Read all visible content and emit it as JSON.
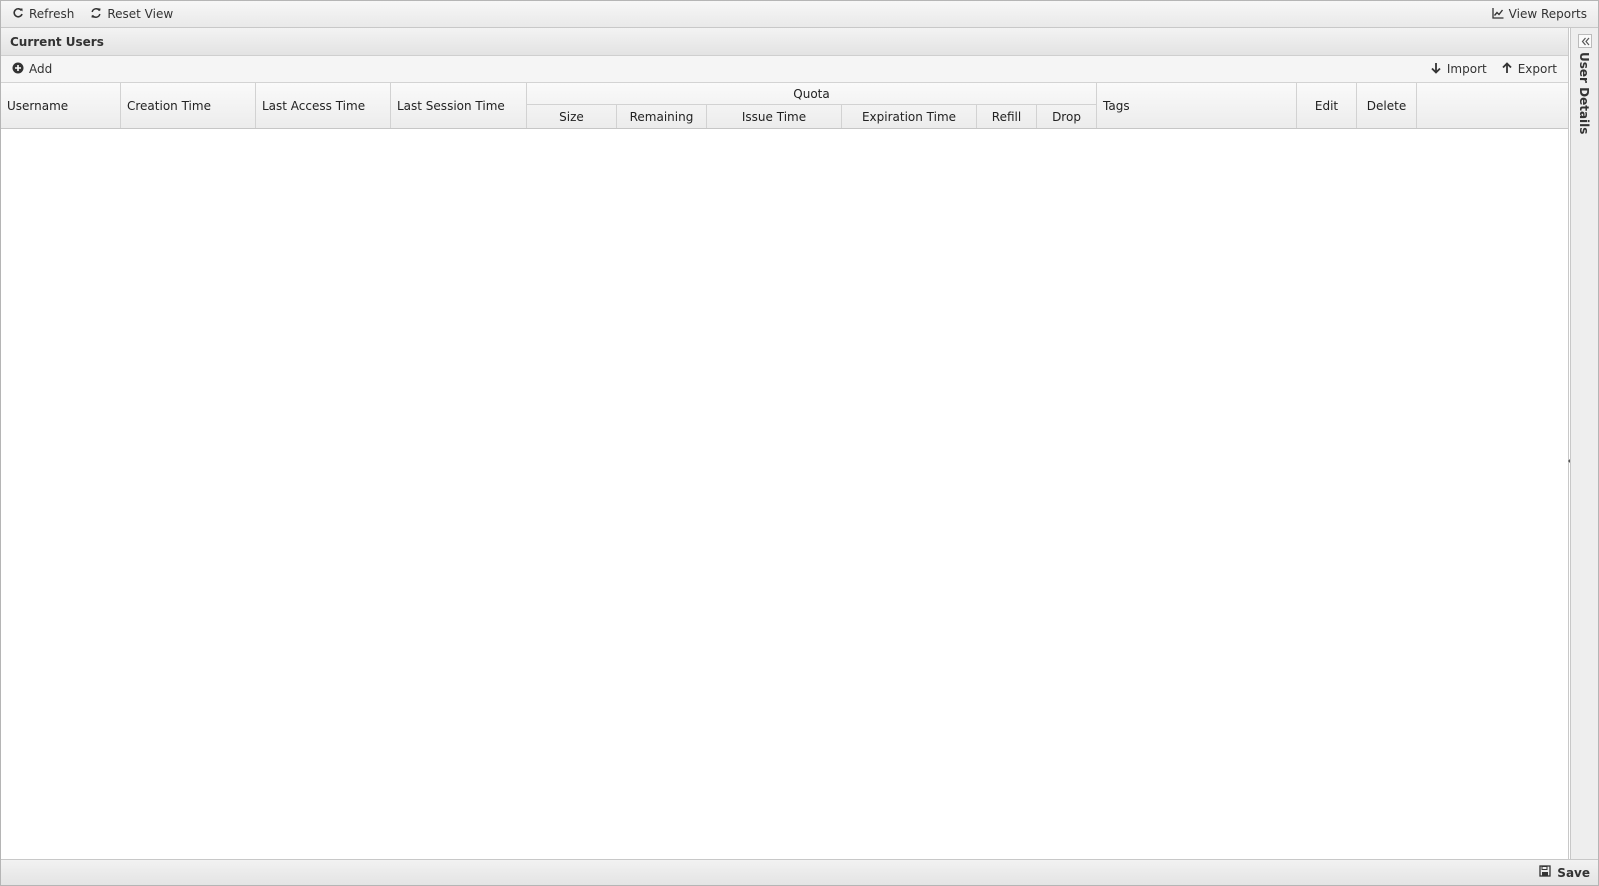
{
  "toolbar": {
    "refresh_label": "Refresh",
    "reset_view_label": "Reset View",
    "view_reports_label": "View Reports"
  },
  "panel": {
    "title": "Current Users"
  },
  "grid_toolbar": {
    "add_label": "Add",
    "import_label": "Import",
    "export_label": "Export"
  },
  "columns": {
    "username": "Username",
    "creation_time": "Creation Time",
    "last_access_time": "Last Access Time",
    "last_session_time": "Last Session Time",
    "quota": {
      "group": "Quota",
      "size": "Size",
      "remaining": "Remaining",
      "issue_time": "Issue Time",
      "expiration_time": "Expiration Time",
      "refill": "Refill",
      "drop": "Drop"
    },
    "tags": "Tags",
    "edit": "Edit",
    "delete": "Delete"
  },
  "rows": [],
  "side_panel": {
    "title": "User Details"
  },
  "footer": {
    "save_label": "Save"
  },
  "colors": {
    "toolbar_bg": "#eeeeee",
    "border": "#c8c8c8",
    "text": "#222222"
  }
}
